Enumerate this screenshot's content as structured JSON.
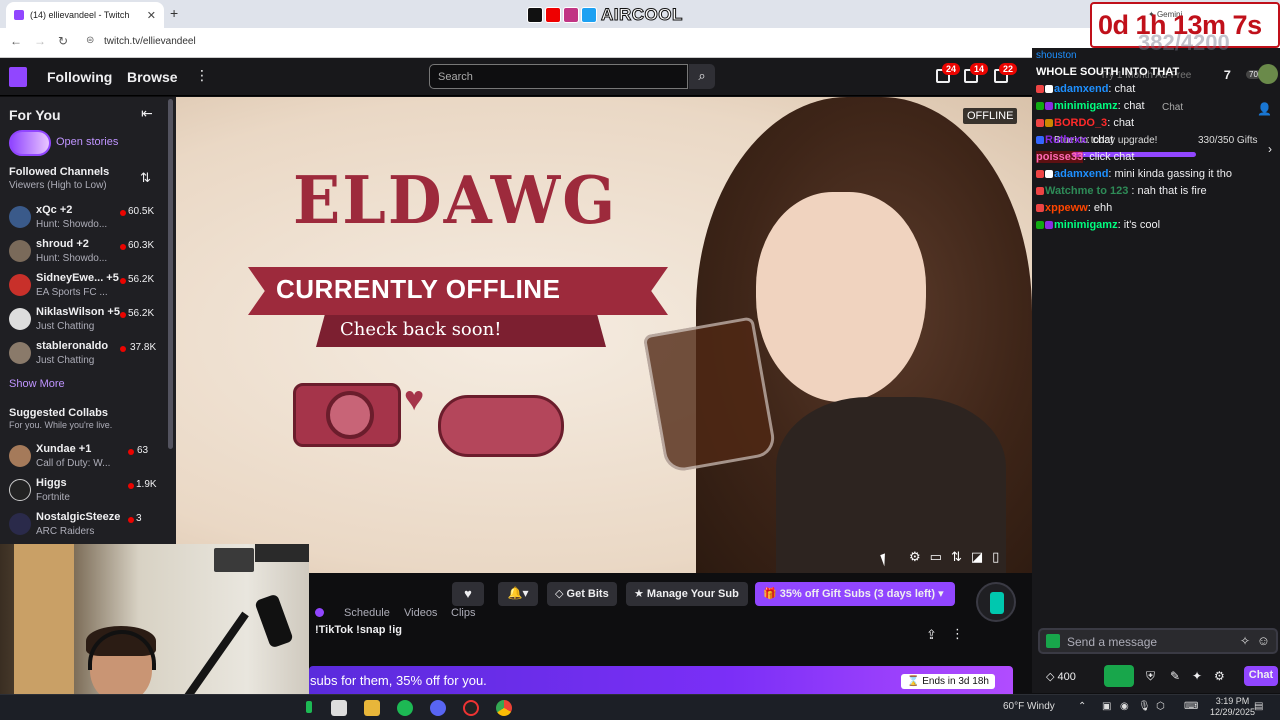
{
  "browser": {
    "tab_title": "(14) ellievandeel - Twitch",
    "url": "twitch.tv/ellievandeel"
  },
  "overlay": {
    "socials_name": "AIRCOOL",
    "timer": "0d 1h 13m 7s",
    "timer_ghost": "382/4200",
    "gemini_label": "Gemini"
  },
  "topnav": {
    "following": "Following",
    "browse": "Browse",
    "search_placeholder": "Search",
    "badges": [
      "24",
      "14",
      "22"
    ],
    "try_prime": "Try 1 Month Ad-Free",
    "avatar_count": "70"
  },
  "sidebar": {
    "title": "For You",
    "open_stories": "Open stories",
    "followed_title": "Followed Channels",
    "followed_sub": "Viewers (High to Low)",
    "channels": [
      {
        "name": "xQc +2",
        "game": "Hunt: Showdo...",
        "viewers": "60.5K"
      },
      {
        "name": "shroud +2",
        "game": "Hunt: Showdo...",
        "viewers": "60.3K"
      },
      {
        "name": "SidneyEwe... +5",
        "game": "EA Sports FC ...",
        "viewers": "56.2K"
      },
      {
        "name": "NiklasWilson +5",
        "game": "Just Chatting",
        "viewers": "56.2K"
      },
      {
        "name": "stableronaldo",
        "game": "Just Chatting",
        "viewers": "37.8K"
      }
    ],
    "show_more": "Show More",
    "collabs_title": "Suggested Collabs",
    "collabs_sub": "For you. While you're live.",
    "collabs": [
      {
        "name": "Xundae +1",
        "game": "Call of Duty: W...",
        "viewers": "63"
      },
      {
        "name": "Higgs",
        "game": "Fortnite",
        "viewers": "1.9K"
      },
      {
        "name": "NostalgicSteeze",
        "game": "ARC Raiders",
        "viewers": "3"
      }
    ]
  },
  "banner": {
    "title": "ELDAWG",
    "ribbon": "CURRENTLY OFFLINE",
    "sub": "Check back soon!",
    "offline_badge": "OFFLINE"
  },
  "infobar": {
    "get_bits": "Get Bits",
    "manage_sub": "Manage Your Sub",
    "gift_subs": "35% off Gift Subs (3 days left)",
    "tabs": [
      "Schedule",
      "Videos",
      "Clips"
    ],
    "title": "!TikTok !snap !ig",
    "promo_text": "subs for them, 35% off for you.",
    "promo_ends": "Ends in 3d 18h"
  },
  "chat": {
    "header": "WHOLE SOUTH INTO THAT",
    "top_user": "shouston",
    "messages": [
      {
        "user": "adamxend",
        "text": "chat",
        "color": "#1e90ff"
      },
      {
        "user": "minimigamz",
        "text": "chat",
        "color": "#00ff7f"
      },
      {
        "user": "BORDO_3",
        "text": "chat",
        "color": "#ff0000"
      },
      {
        "user": "Ruthrxx",
        "text": "chat",
        "color": "#8a2be2"
      },
      {
        "user": "poisse33",
        "text": "click chat",
        "color": "#ff69b4"
      },
      {
        "user": "adamxend",
        "text": "mini kinda gassing it tho",
        "color": "#1e90ff"
      },
      {
        "user": "Watchme to 123 ",
        "text": "nah that is fire",
        "color": "#2e8b57"
      },
      {
        "user": "xppeww",
        "text": "ehh",
        "color": "#ff4500"
      },
      {
        "user": "minimigamz",
        "text": "it's cool",
        "color": "#00ff7f"
      }
    ],
    "ghost_upgrade": "Blue! to today upgrade!",
    "gift_count": "330/350 Gifts",
    "ghost_chat": "Chat",
    "input_placeholder": "Send a message",
    "points": "400",
    "chat_button": "Chat"
  },
  "taskbar": {
    "weather": "60°F  Windy",
    "time": "3:19 PM",
    "date": "12/29/2025"
  },
  "colors": {
    "twitch_purple": "#9146ff",
    "live_red": "#eb0400",
    "banner_maroon": "#9d2a3c"
  }
}
